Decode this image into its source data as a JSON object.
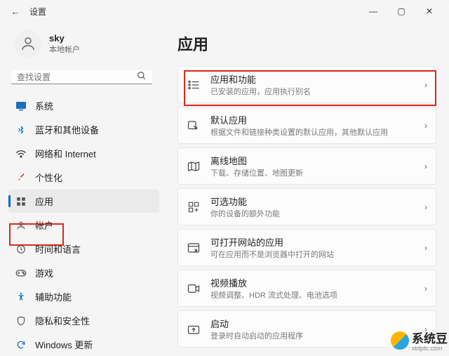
{
  "window": {
    "title": "设置"
  },
  "user": {
    "name": "sky",
    "account_type": "本地帐户"
  },
  "search": {
    "placeholder": "查找设置"
  },
  "nav": {
    "items": [
      {
        "label": "系统",
        "color": "#0067c0"
      },
      {
        "label": "蓝牙和其他设备",
        "color": "#0067c0"
      },
      {
        "label": "网络和 Internet",
        "color": "#0067c0"
      },
      {
        "label": "个性化",
        "color": "#c74634"
      },
      {
        "label": "应用",
        "color": "#555"
      },
      {
        "label": "帐户",
        "color": "#555"
      },
      {
        "label": "时间和语言",
        "color": "#555"
      },
      {
        "label": "游戏",
        "color": "#107c10"
      },
      {
        "label": "辅助功能",
        "color": "#0067c0"
      },
      {
        "label": "隐私和安全性",
        "color": "#555"
      },
      {
        "label": "Windows 更新",
        "color": "#0067c0"
      }
    ]
  },
  "page": {
    "title": "应用",
    "cards": [
      {
        "title": "应用和功能",
        "sub": "已安装的应用，应用执行别名"
      },
      {
        "title": "默认应用",
        "sub": "根据文件和链接种类设置的默认应用，其他默认应用"
      },
      {
        "title": "离线地图",
        "sub": "下载、存储位置、地图更新"
      },
      {
        "title": "可选功能",
        "sub": "你的设备的额外功能"
      },
      {
        "title": "可打开网站的应用",
        "sub": "可在应用而不是浏览器中打开的网站"
      },
      {
        "title": "视频播放",
        "sub": "视频调整、HDR 流式处理、电池选项"
      },
      {
        "title": "启动",
        "sub": "登录时自动启动的应用程序"
      }
    ]
  },
  "watermark": {
    "name": "系统豆",
    "url": "xtdptc.com"
  }
}
